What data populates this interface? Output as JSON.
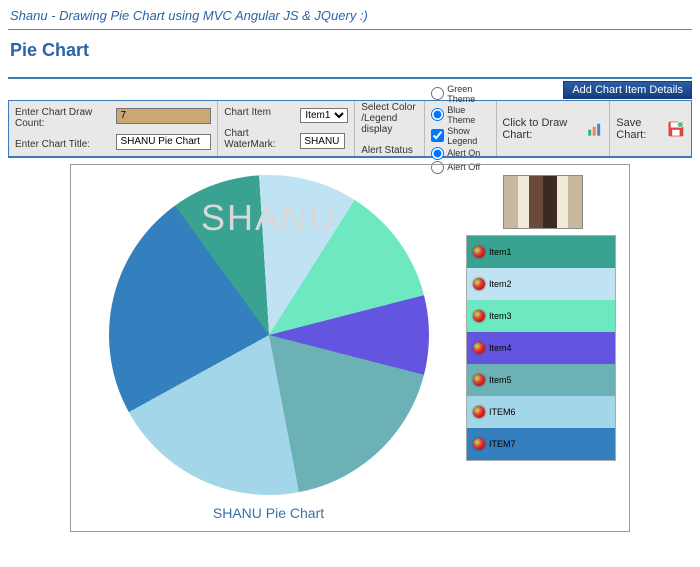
{
  "top_title": "Shanu - Drawing Pie Chart using MVC Angular JS & JQuery :)",
  "page_title": "Pie Chart",
  "add_button": "Add Chart Item Details",
  "toolbar": {
    "draw_count_label": "Enter Chart Draw Count:",
    "draw_count_value": "7",
    "chart_title_label": "Enter Chart Title:",
    "chart_title_value": "SHANU Pie Chart",
    "chart_item_label": "Chart Item",
    "chart_item_value": "Item1",
    "watermark_label": "Chart WaterMark:",
    "watermark_value": "SHANU",
    "select_color_label1": "Select Color",
    "select_color_label2": "/Legend display",
    "alert_status_label": "Alert Status",
    "theme_green": "Green Theme",
    "theme_blue": "Blue Theme",
    "show_legend": "Show Legend",
    "alert_on": "Alert On",
    "alert_off": "Alert Off",
    "click_draw": "Click to Draw Chart:",
    "save_chart": "Save Chart:"
  },
  "chart_data": {
    "type": "pie",
    "title": "SHANU Pie Chart",
    "watermark": "SHANU",
    "series": [
      {
        "name": "Item1",
        "value": 9,
        "color": "#3aa291"
      },
      {
        "name": "Item2",
        "value": 10,
        "color": "#bfe3f2"
      },
      {
        "name": "Item3",
        "value": 12,
        "color": "#6ee8c1"
      },
      {
        "name": "Item4",
        "value": 8,
        "color": "#6455e0"
      },
      {
        "name": "Item5",
        "value": 18,
        "color": "#6bb1b5"
      },
      {
        "name": "ITEM6",
        "value": 20,
        "color": "#a3d6e8"
      },
      {
        "name": "ITEM7",
        "value": 23,
        "color": "#347fbe"
      }
    ]
  }
}
